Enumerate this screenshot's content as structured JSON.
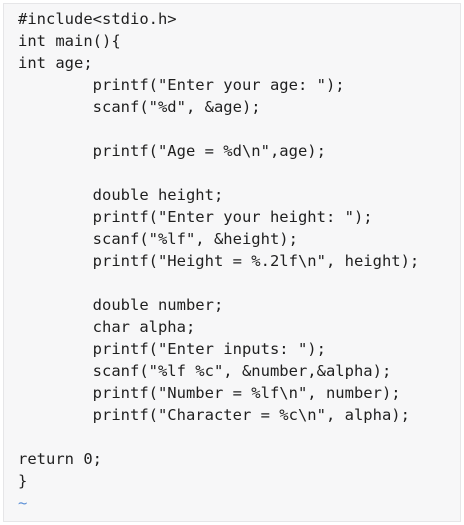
{
  "editor": {
    "lines": [
      "#include<stdio.h>",
      "int main(){",
      "int age;",
      "        printf(\"Enter your age: \");",
      "        scanf(\"%d\", &age);",
      "",
      "        printf(\"Age = %d\\n\",age);",
      "",
      "        double height;",
      "        printf(\"Enter your height: \");",
      "        scanf(\"%lf\", &height);",
      "        printf(\"Height = %.2lf\\n\", height);",
      "",
      "        double number;",
      "        char alpha;",
      "        printf(\"Enter inputs: \");",
      "        scanf(\"%lf %c\", &number,&alpha);",
      "        printf(\"Number = %lf\\n\", number);",
      "        printf(\"Character = %c\\n\", alpha);",
      "",
      "return 0;",
      "}"
    ],
    "empty_markers": [
      "~",
      "~"
    ]
  }
}
